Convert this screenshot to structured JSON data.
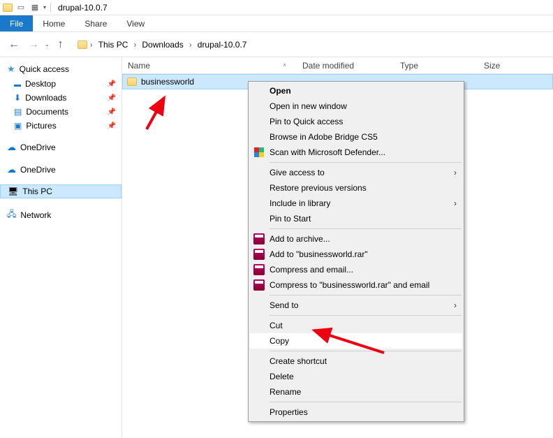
{
  "titlebar": {
    "title": "drupal-10.0.7"
  },
  "ribbon": {
    "file": "File",
    "tabs": [
      "Home",
      "Share",
      "View"
    ]
  },
  "breadcrumb": {
    "parts": [
      "This PC",
      "Downloads",
      "drupal-10.0.7"
    ]
  },
  "sidebar": {
    "quick_access": "Quick access",
    "quick_items": [
      {
        "label": "Desktop",
        "pinned": true
      },
      {
        "label": "Downloads",
        "pinned": true
      },
      {
        "label": "Documents",
        "pinned": true
      },
      {
        "label": "Pictures",
        "pinned": true
      }
    ],
    "onedrive1": "OneDrive",
    "onedrive2": "OneDrive",
    "this_pc": "This PC",
    "network": "Network"
  },
  "columns": {
    "name": "Name",
    "date": "Date modified",
    "type": "Type",
    "size": "Size"
  },
  "file_row": {
    "name": "businessworld"
  },
  "context_menu": {
    "open": "Open",
    "open_new": "Open in new window",
    "pin_qa": "Pin to Quick access",
    "bridge": "Browse in Adobe Bridge CS5",
    "defender": "Scan with Microsoft Defender...",
    "give_access": "Give access to",
    "restore": "Restore previous versions",
    "include_lib": "Include in library",
    "pin_start": "Pin to Start",
    "add_archive": "Add to archive...",
    "add_rar": "Add to \"businessworld.rar\"",
    "compress_email": "Compress and email...",
    "compress_rar_email": "Compress to \"businessworld.rar\" and email",
    "send_to": "Send to",
    "cut": "Cut",
    "copy": "Copy",
    "create_shortcut": "Create shortcut",
    "delete": "Delete",
    "rename": "Rename",
    "properties": "Properties"
  }
}
